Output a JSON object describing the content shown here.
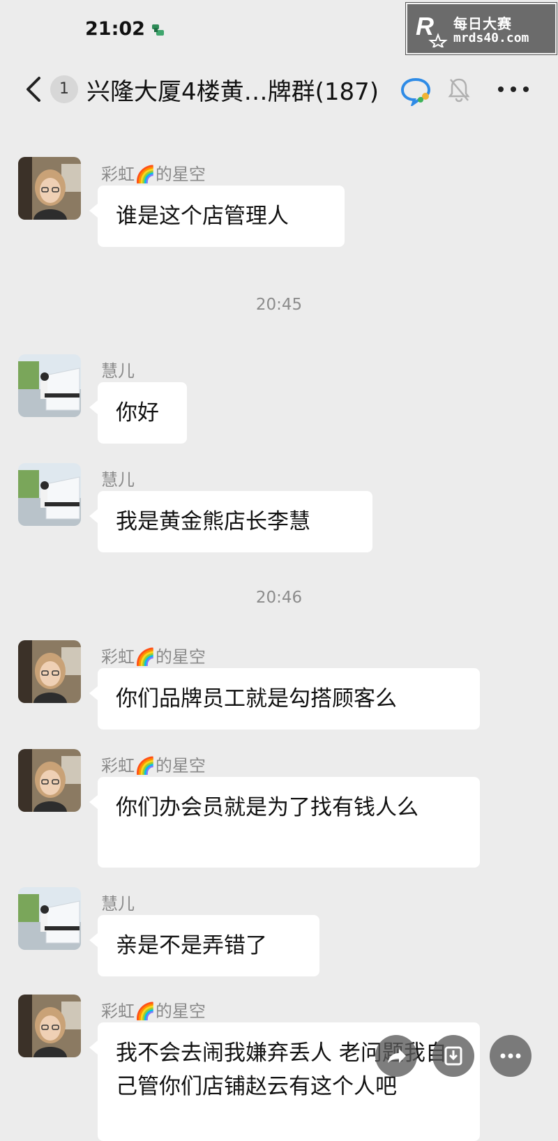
{
  "status_bar": {
    "time": "21:02"
  },
  "watermark": {
    "title": "每日大赛",
    "url": "mrds40.com"
  },
  "header": {
    "unread_count": "1",
    "title": "兴隆大厦4楼黄…牌群(187)"
  },
  "messages": [
    {
      "sender": "彩虹🌈的星空",
      "text": "谁是这个店管理人"
    },
    {
      "timestamp": "20:45"
    },
    {
      "sender": "慧儿",
      "text": "你好"
    },
    {
      "sender": "慧儿",
      "text": "我是黄金熊店长李慧"
    },
    {
      "timestamp": "20:46"
    },
    {
      "sender": "彩虹🌈的星空",
      "text": "你们品牌员工就是勾搭顾客么"
    },
    {
      "sender": "彩虹🌈的星空",
      "text": "你们办会员就是为了找有钱人么"
    },
    {
      "sender": "慧儿",
      "text": "亲是不是弄错了"
    },
    {
      "sender": "彩虹🌈的星空",
      "text": "我不会去闹我嫌弃丢人 老问题我自己管你们店铺赵云有这个人吧"
    }
  ],
  "icons": {
    "back": "chevron-left-icon",
    "chat_bubble": "chat-bubble-icon",
    "mute": "bell-mute-icon",
    "more": "more-horizontal-icon",
    "share": "share-icon",
    "download": "download-icon"
  }
}
